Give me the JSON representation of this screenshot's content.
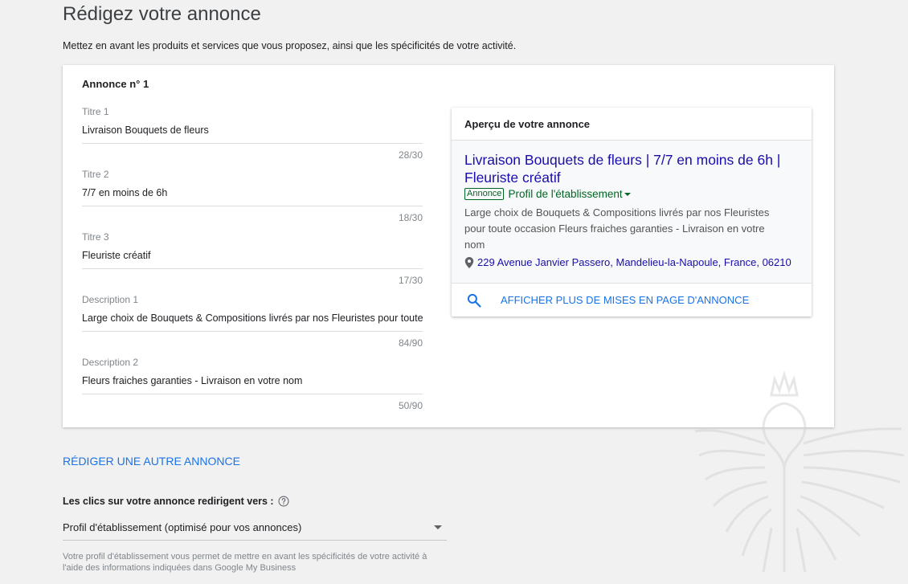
{
  "page": {
    "title": "Rédigez votre annonce",
    "subtitle": "Mettez en avant les produits et services que vous proposez, ainsi que les spécificités de votre activité."
  },
  "ad_card": {
    "title": "Annonce n° 1",
    "fields": [
      {
        "label": "Titre 1",
        "value": "Livraison Bouquets de fleurs",
        "count": "28/30"
      },
      {
        "label": "Titre 2",
        "value": "7/7 en moins de 6h",
        "count": "18/30"
      },
      {
        "label": "Titre 3",
        "value": "Fleuriste créatif",
        "count": "17/30"
      },
      {
        "label": "Description 1",
        "value": "Large choix de Bouquets & Compositions livrés par nos Fleuristes pour toute occasion",
        "count": "84/90"
      },
      {
        "label": "Description 2",
        "value": "Fleurs fraiches garanties - Livraison en votre nom",
        "count": "50/90"
      }
    ]
  },
  "preview": {
    "title": "Aperçu de votre annonce",
    "headline": "Livraison Bouquets de fleurs | 7/7 en moins de 6h | Fleuriste créatif",
    "badge": "Annonce",
    "profile_link": "Profil de l'établissement",
    "description": "Large choix de Bouquets & Compositions livrés par nos Fleuristes pour toute occasion Fleurs fraiches garanties - Livraison en votre nom",
    "address": "229 Avenue Janvier Passero, Mandelieu-la-Napoule, France, 06210",
    "more_link": "AFFICHER PLUS DE MISES EN PAGE D'ANNONCE",
    "icons": {
      "pin": "location-pin-icon",
      "search": "search-icon"
    },
    "colors": {
      "headline": "#1a0dab",
      "green": "#006621",
      "accent": "#1a73e8"
    }
  },
  "actions": {
    "add_ad": "RÉDIGER UNE AUTRE ANNONCE"
  },
  "clicks": {
    "label": "Les clics sur votre annonce redirigent vers :",
    "selected": "Profil d'établissement (optimisé pour vos annonces)",
    "helper": "Votre profil d'établissement vous permet de mettre en avant les spécificités de votre activité à l'aide des informations indiquées dans Google My Business"
  }
}
